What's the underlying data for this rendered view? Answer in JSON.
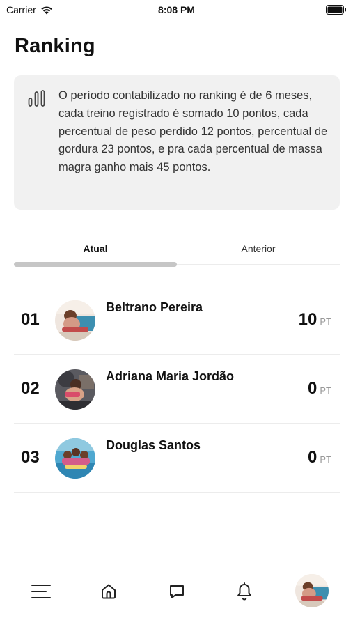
{
  "status_bar": {
    "carrier": "Carrier",
    "time": "8:08 PM"
  },
  "page": {
    "title": "Ranking"
  },
  "info": {
    "icon": "bar-chart-icon",
    "text": "O período contabilizado no ranking é de 6 meses, cada treino registrado é somado 10 pontos, cada percentual de peso perdido 12 pontos, percentual de gordura 23 pontos, e pra cada percentual de massa magra ganho mais 45 pontos."
  },
  "tabs": [
    {
      "label": "Atual",
      "selected": true
    },
    {
      "label": "Anterior",
      "selected": false
    }
  ],
  "ranking": [
    {
      "position": "01",
      "name": "Beltrano Pereira",
      "score": "10",
      "unit": "PT"
    },
    {
      "position": "02",
      "name": "Adriana Maria Jordão",
      "score": "0",
      "unit": "PT"
    },
    {
      "position": "03",
      "name": "Douglas Santos",
      "score": "0",
      "unit": "PT"
    }
  ],
  "bottom_nav": [
    {
      "icon": "menu-icon"
    },
    {
      "icon": "home-icon"
    },
    {
      "icon": "chat-icon"
    },
    {
      "icon": "bell-icon"
    },
    {
      "icon": "profile-avatar"
    }
  ],
  "colors": {
    "info_background": "#f1f1f1",
    "tab_indicator": "#c6c6c6",
    "divider": "#ececec",
    "unit_text": "#999999"
  }
}
